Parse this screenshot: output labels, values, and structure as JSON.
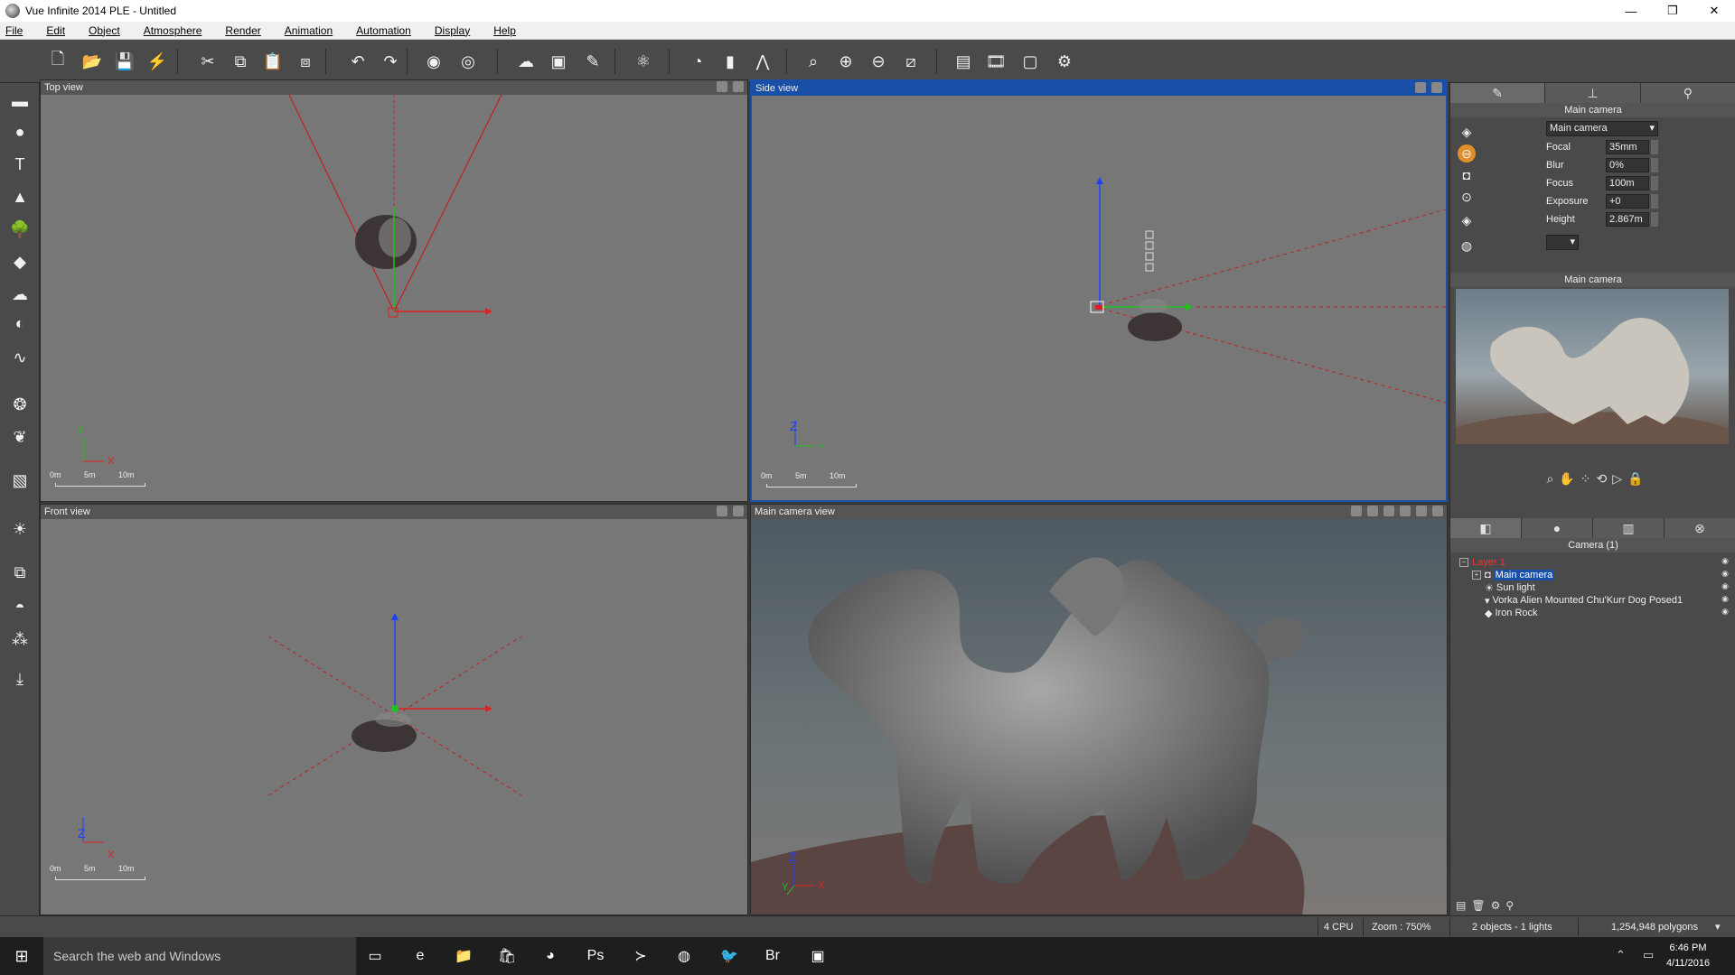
{
  "window": {
    "title": "Vue Infinite 2014 PLE - Untitled",
    "minimize": "—",
    "maximize": "❐",
    "close": "✕"
  },
  "menu": [
    "File",
    "Edit",
    "Object",
    "Atmosphere",
    "Render",
    "Animation",
    "Automation",
    "Display",
    "Help"
  ],
  "toolbar": {
    "icons": [
      "new-icon",
      "open-icon",
      "save-icon",
      "publish-icon",
      "cut-icon",
      "copy-icon",
      "paste-icon",
      "duplicate-icon",
      "undo-icon",
      "redo-icon",
      "render-icon",
      "render-area-icon",
      "atmosphere-icon",
      "material-icon",
      "terrain-editor-icon",
      "color-balls-icon",
      "camera-icon",
      "bar-icon",
      "flip-icon",
      "zoom-fit-icon",
      "zoom-in-icon",
      "zoom-out-icon",
      "frame-icon",
      "render-preview-icon",
      "timeline-icon",
      "safe-frame-icon",
      "options-icon"
    ],
    "glyphs": [
      "🗋",
      "📂",
      "💾",
      "⚡",
      "✂",
      "⧉",
      "📋",
      "⧈",
      "↶",
      "↷",
      "◉",
      "◎",
      "☁",
      "▣",
      "✎",
      "⚛",
      "◔",
      "▮",
      "⋀",
      "⌕",
      "⊕",
      "⊖",
      "⧄",
      "▤",
      "🎞",
      "▢",
      "⚙"
    ]
  },
  "left_tools": {
    "icons": [
      "layers-icon",
      "sphere-icon",
      "text-icon",
      "terrain-icon",
      "tree-icon",
      "rock-icon",
      "cloud-icon",
      "planet-icon",
      "path-icon",
      "ecosystem-icon",
      "plant-icon",
      "box-icon",
      "light-icon",
      "group-icon",
      "boolean-icon",
      "metablob-icon",
      "import-icon"
    ],
    "glyphs": [
      "▬",
      "●",
      "T",
      "▲",
      "🌳",
      "◆",
      "☁",
      "◐",
      "∿",
      "❂",
      "❦",
      "▧",
      "☀",
      "⧉",
      "◓",
      "⁂",
      "⤓"
    ]
  },
  "viewports": {
    "top": {
      "title": "Top view",
      "axis_a": "Y",
      "axis_b": "X"
    },
    "side": {
      "title": "Side view",
      "axis_a": "Z",
      "axis_b": "Y"
    },
    "front": {
      "title": "Front view",
      "axis_a": "Z",
      "axis_b": "X"
    },
    "camera": {
      "title": "Main camera view",
      "axis_a": "Z",
      "axis_b": "X",
      "axis_c": "Y"
    },
    "scale": [
      "0m",
      "5m",
      "10m"
    ]
  },
  "right_panel": {
    "section_title": "Main camera",
    "camera_select": "Main camera",
    "props": [
      {
        "label": "Focal",
        "value": "35mm"
      },
      {
        "label": "Blur",
        "value": "0%"
      },
      {
        "label": "Focus",
        "value": "100m"
      },
      {
        "label": "Exposure",
        "value": "+0"
      },
      {
        "label": "Height",
        "value": "2.867m"
      }
    ],
    "preview_title": "Main camera",
    "tree_title": "Camera (1)",
    "tree": [
      {
        "label": "Layer 1",
        "expander": "−"
      },
      {
        "label": "Main camera",
        "expander": "+"
      },
      {
        "label": "Sun light"
      },
      {
        "label": "Vorka Alien Mounted Chu'Kurr Dog Posed1"
      },
      {
        "label": "Iron Rock"
      }
    ]
  },
  "status": {
    "cpu": "4 CPU",
    "zoom": "Zoom : 750%",
    "objects": "2 objects - 1 lights",
    "polygons": "1,254,948 polygons"
  },
  "taskbar": {
    "search_placeholder": "Search the web and Windows",
    "time": "6:46 PM",
    "date": "4/11/2016",
    "apps": [
      "task-view-icon",
      "edge-icon",
      "explorer-icon",
      "store-icon",
      "chrome-icon",
      "photoshop-icon",
      "terminal-icon",
      "vue-icon",
      "twitter-icon",
      "bridge-icon",
      "app-icon"
    ],
    "app_glyphs": [
      "▭",
      "e",
      "📁",
      "🛍",
      "◕",
      "Ps",
      "≻",
      "◍",
      "🐦",
      "Br",
      "▣"
    ]
  },
  "colors": {
    "active_header": "#1a4fa8",
    "axis_x": "#e02020",
    "axis_y": "#20c020",
    "axis_z": "#2040ff",
    "frustum": "#c02020"
  }
}
